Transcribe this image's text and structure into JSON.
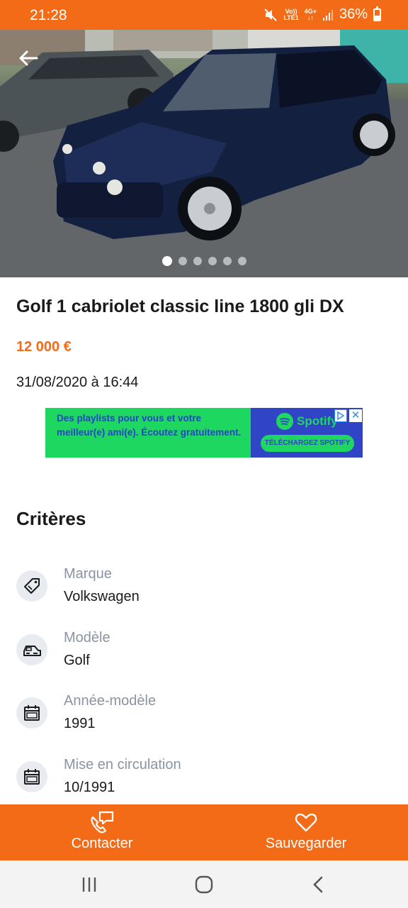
{
  "status_bar": {
    "time": "21:28",
    "network_top": "Vo))",
    "network_bottom": "LTE1",
    "data_top": "4G+",
    "battery": "36%",
    "icons": [
      "mute-icon",
      "signal-icon",
      "battery-icon"
    ]
  },
  "gallery": {
    "image_count": 6,
    "active_index": 0,
    "back_icon": "arrow-left-icon"
  },
  "listing": {
    "title": "Golf 1 cabriolet classic line 1800 gli DX",
    "price": "12 000 €",
    "date": "31/08/2020 à 16:44"
  },
  "ad": {
    "text": "Des playlists pour vous et votre meilleur(e) ami(e). Écoutez gratuitement.",
    "brand": "Spotify",
    "cta": "TÉLÉCHARGEZ SPOTIFY",
    "close_symbol": "✕"
  },
  "criteria": {
    "heading": "Critères",
    "items": [
      {
        "label": "Marque",
        "value": "Volkswagen",
        "icon": "tag-icon"
      },
      {
        "label": "Modèle",
        "value": "Golf",
        "icon": "car-icon"
      },
      {
        "label": "Année-modèle",
        "value": "1991",
        "icon": "calendar-icon"
      },
      {
        "label": "Mise en circulation",
        "value": "10/1991",
        "icon": "calendar-icon"
      }
    ]
  },
  "actions": {
    "contact_label": "Contacter",
    "save_label": "Sauvegarder"
  },
  "colors": {
    "accent": "#f36b16",
    "criteria_label": "#8a94a2",
    "ad_green": "#1ed760",
    "ad_blue": "#2f45c6"
  }
}
